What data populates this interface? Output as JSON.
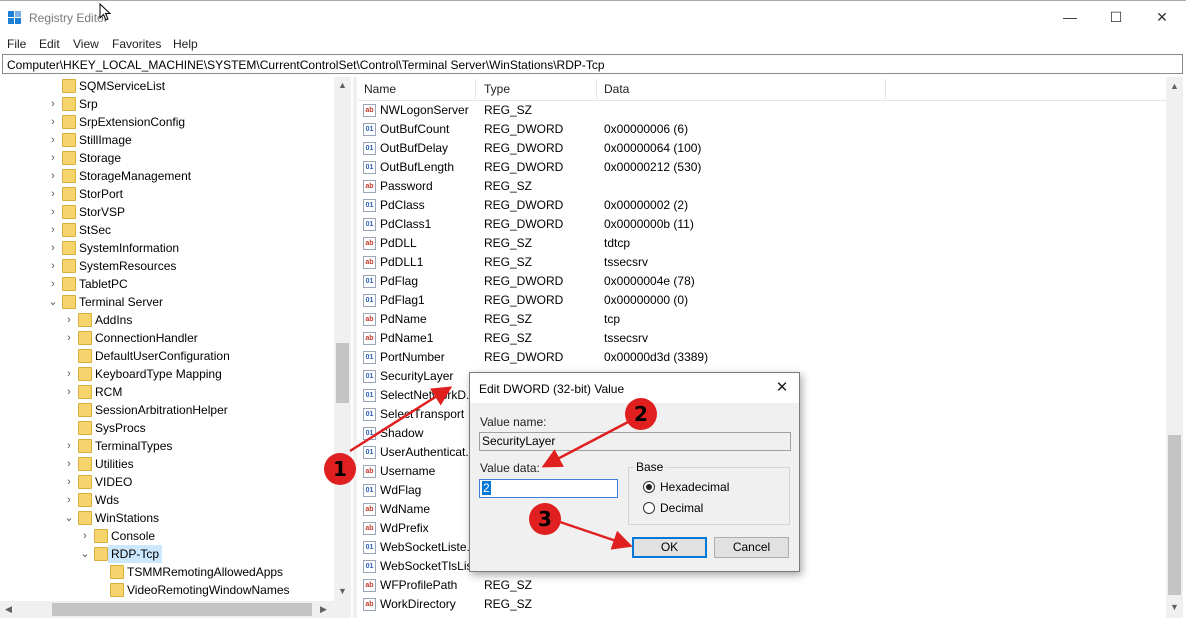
{
  "window": {
    "title": "Registry Editor",
    "minimize": "—",
    "maximize": "☐",
    "close": "✕"
  },
  "menu": [
    "File",
    "Edit",
    "View",
    "Favorites",
    "Help"
  ],
  "address": "Computer\\HKEY_LOCAL_MACHINE\\SYSTEM\\CurrentControlSet\\Control\\Terminal Server\\WinStations\\RDP-Tcp",
  "tree": [
    {
      "label": "SQMServiceList",
      "chev": ""
    },
    {
      "label": "Srp",
      "chev": "›"
    },
    {
      "label": "SrpExtensionConfig",
      "chev": "›"
    },
    {
      "label": "StillImage",
      "chev": "›"
    },
    {
      "label": "Storage",
      "chev": "›"
    },
    {
      "label": "StorageManagement",
      "chev": "›"
    },
    {
      "label": "StorPort",
      "chev": "›"
    },
    {
      "label": "StorVSP",
      "chev": "›"
    },
    {
      "label": "StSec",
      "chev": "›"
    },
    {
      "label": "SystemInformation",
      "chev": "›"
    },
    {
      "label": "SystemResources",
      "chev": "›"
    },
    {
      "label": "TabletPC",
      "chev": "›"
    },
    {
      "label": "Terminal Server",
      "chev": "⌄"
    },
    {
      "label": "AddIns",
      "chev": "›"
    },
    {
      "label": "ConnectionHandler",
      "chev": "›"
    },
    {
      "label": "DefaultUserConfiguration",
      "chev": ""
    },
    {
      "label": "KeyboardType Mapping",
      "chev": "›"
    },
    {
      "label": "RCM",
      "chev": "›"
    },
    {
      "label": "SessionArbitrationHelper",
      "chev": ""
    },
    {
      "label": "SysProcs",
      "chev": ""
    },
    {
      "label": "TerminalTypes",
      "chev": "›"
    },
    {
      "label": "Utilities",
      "chev": "›"
    },
    {
      "label": "VIDEO",
      "chev": "›"
    },
    {
      "label": "Wds",
      "chev": "›"
    },
    {
      "label": "WinStations",
      "chev": "⌄"
    },
    {
      "label": "Console",
      "chev": "›"
    },
    {
      "label": "RDP-Tcp",
      "chev": "⌄"
    },
    {
      "label": "TSMMRemotingAllowedApps",
      "chev": ""
    },
    {
      "label": "VideoRemotingWindowNames",
      "chev": ""
    }
  ],
  "list": {
    "headers": {
      "name": "Name",
      "type": "Type",
      "data": "Data"
    },
    "rows": [
      {
        "name": "NWLogonServer",
        "type": "REG_SZ",
        "data": "",
        "kind": "sz"
      },
      {
        "name": "OutBufCount",
        "type": "REG_DWORD",
        "data": "0x00000006 (6)",
        "kind": "dw"
      },
      {
        "name": "OutBufDelay",
        "type": "REG_DWORD",
        "data": "0x00000064 (100)",
        "kind": "dw"
      },
      {
        "name": "OutBufLength",
        "type": "REG_DWORD",
        "data": "0x00000212 (530)",
        "kind": "dw"
      },
      {
        "name": "Password",
        "type": "REG_SZ",
        "data": "",
        "kind": "sz"
      },
      {
        "name": "PdClass",
        "type": "REG_DWORD",
        "data": "0x00000002 (2)",
        "kind": "dw"
      },
      {
        "name": "PdClass1",
        "type": "REG_DWORD",
        "data": "0x0000000b (11)",
        "kind": "dw"
      },
      {
        "name": "PdDLL",
        "type": "REG_SZ",
        "data": "tdtcp",
        "kind": "sz"
      },
      {
        "name": "PdDLL1",
        "type": "REG_SZ",
        "data": "tssecsrv",
        "kind": "sz"
      },
      {
        "name": "PdFlag",
        "type": "REG_DWORD",
        "data": "0x0000004e (78)",
        "kind": "dw"
      },
      {
        "name": "PdFlag1",
        "type": "REG_DWORD",
        "data": "0x00000000 (0)",
        "kind": "dw"
      },
      {
        "name": "PdName",
        "type": "REG_SZ",
        "data": "tcp",
        "kind": "sz"
      },
      {
        "name": "PdName1",
        "type": "REG_SZ",
        "data": "tssecsrv",
        "kind": "sz"
      },
      {
        "name": "PortNumber",
        "type": "REG_DWORD",
        "data": "0x00000d3d (3389)",
        "kind": "dw"
      },
      {
        "name": "SecurityLayer",
        "type": "",
        "data": "",
        "kind": "dw"
      },
      {
        "name": "SelectNetworkD...",
        "type": "",
        "data": "",
        "kind": "dw"
      },
      {
        "name": "SelectTransport",
        "type": "",
        "data": "",
        "kind": "dw"
      },
      {
        "name": "Shadow",
        "type": "",
        "data": "",
        "kind": "dw"
      },
      {
        "name": "UserAuthenticat...",
        "type": "",
        "data": "",
        "kind": "dw"
      },
      {
        "name": "Username",
        "type": "",
        "data": "",
        "kind": "sz"
      },
      {
        "name": "WdFlag",
        "type": "",
        "data": "",
        "kind": "dw"
      },
      {
        "name": "WdName",
        "type": "",
        "data": "",
        "kind": "sz"
      },
      {
        "name": "WdPrefix",
        "type": "",
        "data": "",
        "kind": "sz"
      },
      {
        "name": "WebSocketListe...",
        "type": "",
        "data": "",
        "kind": "dw"
      },
      {
        "name": "WebSocketTlsLis...",
        "type": "",
        "data": "",
        "kind": "dw"
      },
      {
        "name": "WFProfilePath",
        "type": "REG_SZ",
        "data": "",
        "kind": "sz"
      },
      {
        "name": "WorkDirectory",
        "type": "REG_SZ",
        "data": "",
        "kind": "sz"
      }
    ]
  },
  "dialog": {
    "title": "Edit DWORD (32-bit) Value",
    "close": "✕",
    "value_name_label": "Value name:",
    "value_name": "SecurityLayer",
    "value_data_label": "Value data:",
    "value_data": "2",
    "base_label": "Base",
    "hex_label": "Hexadecimal",
    "dec_label": "Decimal",
    "selected_base": "hexadecimal",
    "ok": "OK",
    "cancel": "Cancel"
  },
  "annotations": [
    "1",
    "2",
    "3"
  ],
  "colors": {
    "annotation": "#e02020",
    "selection": "#cce8ff",
    "accent": "#0078d7"
  }
}
